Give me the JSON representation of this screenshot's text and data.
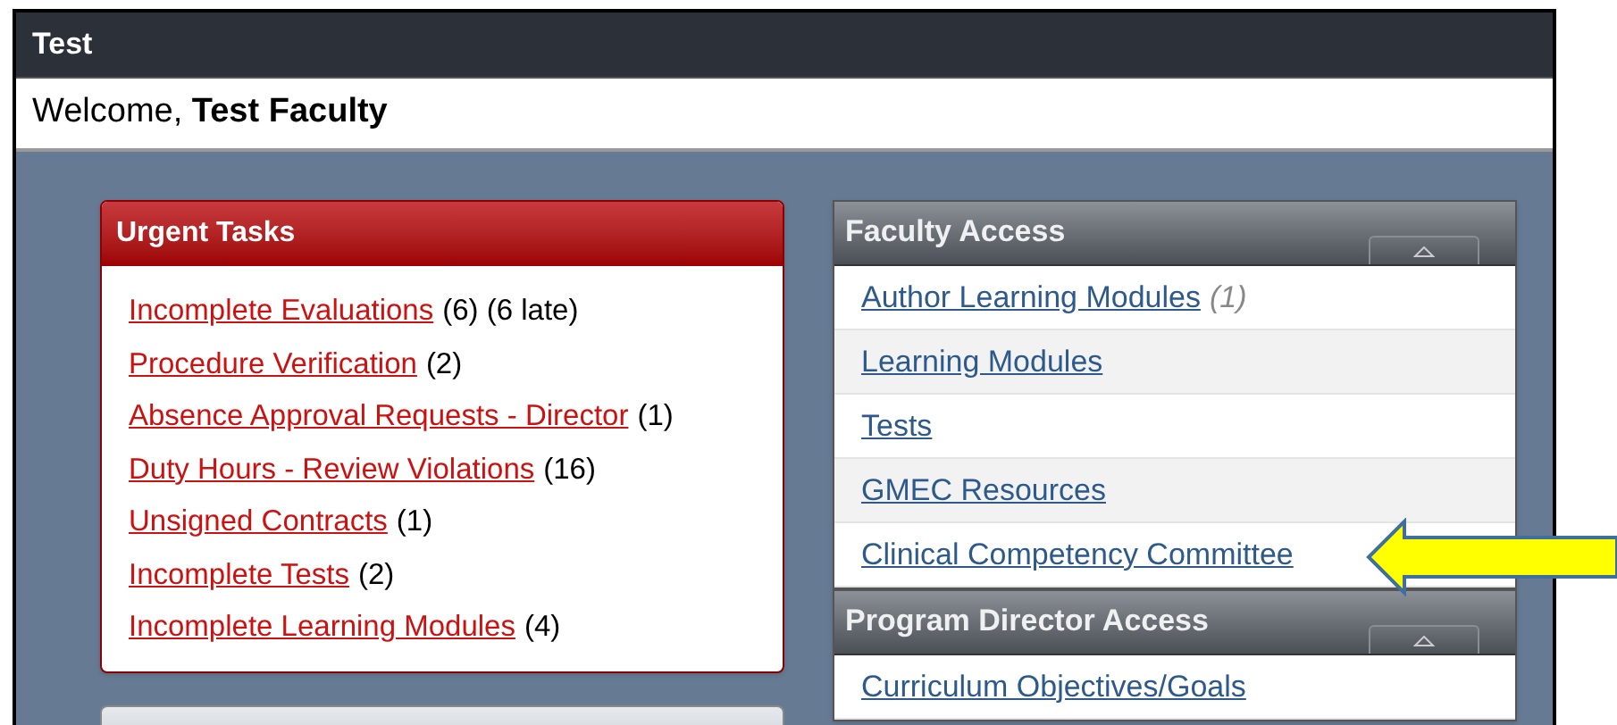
{
  "header": {
    "title": "Test"
  },
  "welcome": {
    "greeting": "Welcome,",
    "name": "Test Faculty"
  },
  "urgent_tasks": {
    "title": "Urgent Tasks",
    "items": [
      {
        "link": "Incomplete Evaluations",
        "count": "(6) (6 late)"
      },
      {
        "link": "Procedure Verification",
        "count": "(2)"
      },
      {
        "link": "Absence Approval Requests - Director",
        "count": "(1)"
      },
      {
        "link": "Duty Hours - Review Violations",
        "count": "(16)"
      },
      {
        "link": "Unsigned Contracts",
        "count": "(1)"
      },
      {
        "link": "Incomplete Tests",
        "count": "(2)"
      },
      {
        "link": "Incomplete Learning Modules",
        "count": "(4)"
      }
    ]
  },
  "faculty_access": {
    "title": "Faculty Access",
    "expanded": true,
    "items": [
      {
        "label": "Author Learning Modules",
        "count": "(1)"
      },
      {
        "label": "Learning Modules"
      },
      {
        "label": "Tests"
      },
      {
        "label": "GMEC Resources"
      },
      {
        "label": "Clinical Competency Committee"
      }
    ]
  },
  "program_director_access": {
    "title": "Program Director Access",
    "expanded": true,
    "items": [
      {
        "label": "Curriculum Objectives/Goals"
      }
    ]
  }
}
